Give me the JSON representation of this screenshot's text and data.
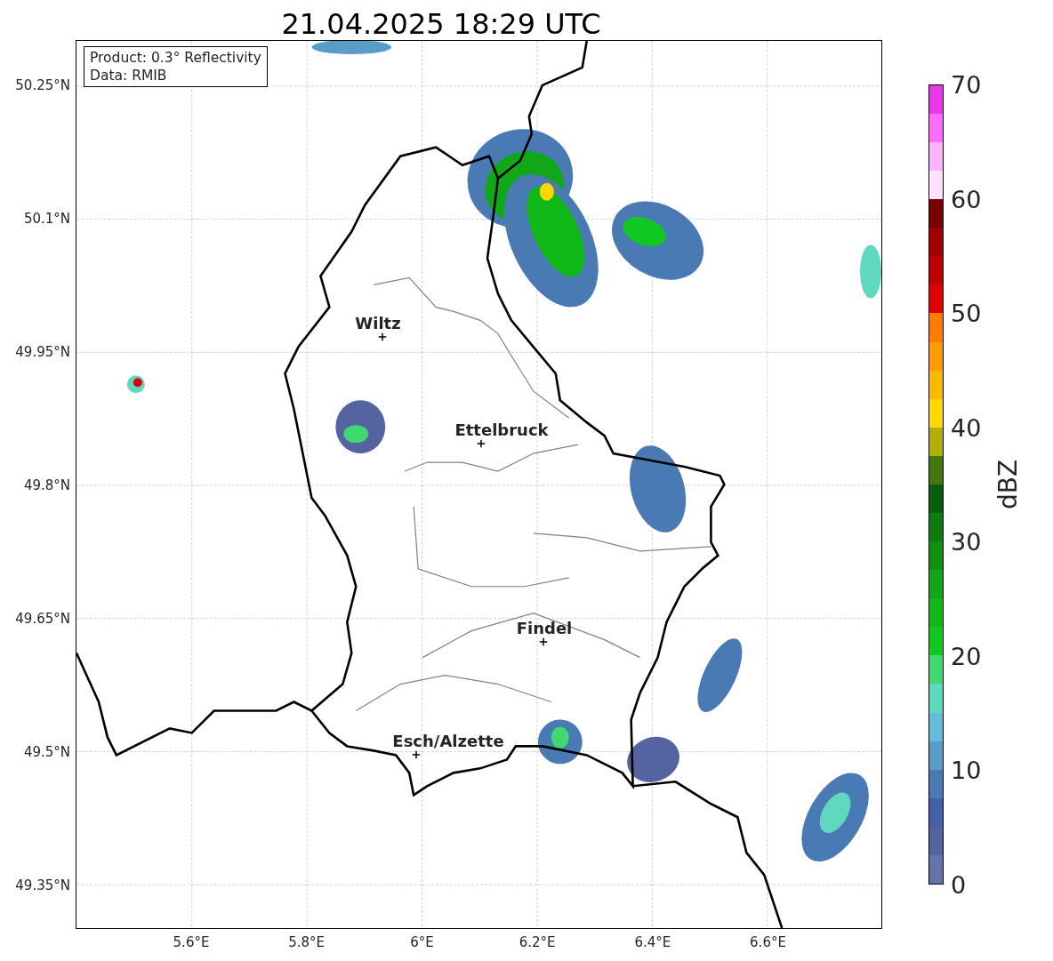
{
  "title": "21.04.2025 18:29 UTC",
  "info_box": {
    "lines": [
      "Product: 0.3° Reflectivity",
      "Data: RMIB"
    ]
  },
  "map": {
    "cities": [
      {
        "name": "Wiltz"
      },
      {
        "name": "Ettelbruck"
      },
      {
        "name": "Findel"
      },
      {
        "name": "Esch/Alzette"
      }
    ]
  },
  "x_axis": {
    "ticks": [
      "5.6°E",
      "5.8°E",
      "6°E",
      "6.2°E",
      "6.4°E",
      "6.6°E"
    ]
  },
  "y_axis": {
    "ticks": [
      "50.25°N",
      "50.1°N",
      "49.95°N",
      "49.8°N",
      "49.65°N",
      "49.5°N",
      "49.35°N"
    ]
  },
  "colorbar": {
    "label": "dBZ",
    "ticks": [
      "70",
      "60",
      "50",
      "40",
      "30",
      "20",
      "10",
      "0"
    ],
    "segments": [
      {
        "color": "#6474a8"
      },
      {
        "color": "#5464a0"
      },
      {
        "color": "#4460a8"
      },
      {
        "color": "#4a7ab4"
      },
      {
        "color": "#5a9cc8"
      },
      {
        "color": "#64bcd8"
      },
      {
        "color": "#60d8c0"
      },
      {
        "color": "#40d870"
      },
      {
        "color": "#10c820"
      },
      {
        "color": "#10b818"
      },
      {
        "color": "#10a818"
      },
      {
        "color": "#109010"
      },
      {
        "color": "#0c7c10"
      },
      {
        "color": "#085e0c"
      },
      {
        "color": "#447810"
      },
      {
        "color": "#b0b008"
      },
      {
        "color": "#ffd800"
      },
      {
        "color": "#ffb800"
      },
      {
        "color": "#ff9c00"
      },
      {
        "color": "#ff7c00"
      },
      {
        "color": "#e00000"
      },
      {
        "color": "#c00000"
      },
      {
        "color": "#a00000"
      },
      {
        "color": "#780000"
      },
      {
        "color": "#ffe0ff"
      },
      {
        "color": "#ffb4ff"
      },
      {
        "color": "#ff6cff"
      },
      {
        "color": "#e838e8"
      }
    ]
  }
}
